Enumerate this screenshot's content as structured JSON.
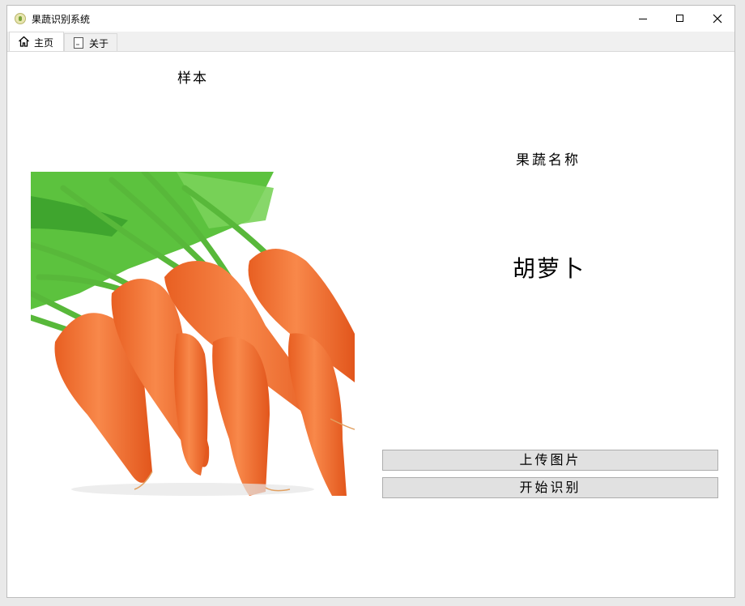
{
  "window": {
    "title": "果蔬识别系统"
  },
  "tabs": [
    {
      "label": "主页",
      "icon": "home-icon",
      "active": true
    },
    {
      "label": "关于",
      "icon": "document-icon",
      "active": false
    }
  ],
  "main": {
    "sample_label": "样本",
    "name_label": "果蔬名称",
    "result": "胡萝卜",
    "upload_button": "上传图片",
    "start_button": "开始识别",
    "sample_image": "carrot-photo"
  },
  "colors": {
    "carrot": "#f07a3a",
    "leaf": "#4fbf3a",
    "button": "#e1e1e1"
  }
}
